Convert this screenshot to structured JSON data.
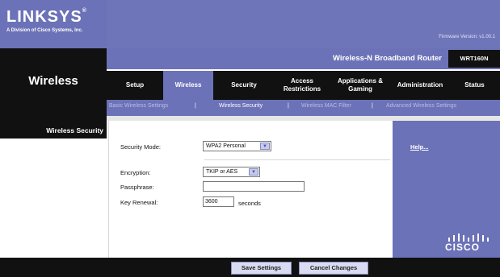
{
  "brand": {
    "logo": "LINKSYS",
    "logo_mark": "®",
    "subtitle": "A Division of Cisco Systems, Inc.",
    "firmware": "Firmware Version: v1.00.1"
  },
  "product": {
    "name": "Wireless-N Broadband Router",
    "model": "WRT160N"
  },
  "page_title": "Wireless",
  "tabs": [
    {
      "label": "Setup"
    },
    {
      "label": "Wireless",
      "active": true
    },
    {
      "label": "Security"
    },
    {
      "label": "Access Restrictions"
    },
    {
      "label": "Applications & Gaming"
    },
    {
      "label": "Administration"
    },
    {
      "label": "Status"
    }
  ],
  "subtabs": [
    {
      "label": "Basic Wireless Settings"
    },
    {
      "label": "Wireless Security",
      "active": true
    },
    {
      "label": "Wireless MAC Filter"
    },
    {
      "label": "Advanced Wireless Settings"
    }
  ],
  "subtab_separator": "|",
  "section": {
    "title": "Wireless Security"
  },
  "form": {
    "security_mode_label": "Security Mode:",
    "security_mode_value": "WPA2 Personal",
    "encryption_label": "Encryption:",
    "encryption_value": "TKIP or AES",
    "passphrase_label": "Passphrase:",
    "passphrase_value": "",
    "key_renewal_label": "Key Renewal:",
    "key_renewal_value": "3600",
    "key_renewal_unit": "seconds"
  },
  "help": {
    "link": "Help..."
  },
  "buttons": {
    "save": "Save Settings",
    "cancel": "Cancel Changes"
  },
  "footer_logo": "CISCO",
  "colors": {
    "brand_purple": "#6c72b7",
    "dark": "#111111",
    "inactive_subtab": "#b9bde6"
  },
  "icons": {
    "dropdown": "chevron-down-icon",
    "cisco": "cisco-logo-icon"
  }
}
